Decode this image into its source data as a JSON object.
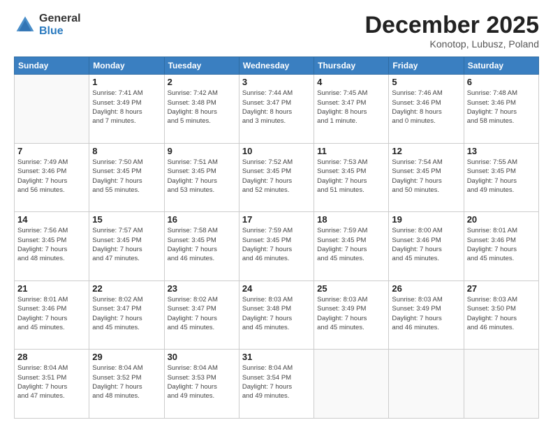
{
  "header": {
    "logo_general": "General",
    "logo_blue": "Blue",
    "month_title": "December 2025",
    "subtitle": "Konotop, Lubusz, Poland"
  },
  "weekdays": [
    "Sunday",
    "Monday",
    "Tuesday",
    "Wednesday",
    "Thursday",
    "Friday",
    "Saturday"
  ],
  "weeks": [
    [
      {
        "day": "",
        "info": ""
      },
      {
        "day": "1",
        "info": "Sunrise: 7:41 AM\nSunset: 3:49 PM\nDaylight: 8 hours\nand 7 minutes."
      },
      {
        "day": "2",
        "info": "Sunrise: 7:42 AM\nSunset: 3:48 PM\nDaylight: 8 hours\nand 5 minutes."
      },
      {
        "day": "3",
        "info": "Sunrise: 7:44 AM\nSunset: 3:47 PM\nDaylight: 8 hours\nand 3 minutes."
      },
      {
        "day": "4",
        "info": "Sunrise: 7:45 AM\nSunset: 3:47 PM\nDaylight: 8 hours\nand 1 minute."
      },
      {
        "day": "5",
        "info": "Sunrise: 7:46 AM\nSunset: 3:46 PM\nDaylight: 8 hours\nand 0 minutes."
      },
      {
        "day": "6",
        "info": "Sunrise: 7:48 AM\nSunset: 3:46 PM\nDaylight: 7 hours\nand 58 minutes."
      }
    ],
    [
      {
        "day": "7",
        "info": "Sunrise: 7:49 AM\nSunset: 3:46 PM\nDaylight: 7 hours\nand 56 minutes."
      },
      {
        "day": "8",
        "info": "Sunrise: 7:50 AM\nSunset: 3:45 PM\nDaylight: 7 hours\nand 55 minutes."
      },
      {
        "day": "9",
        "info": "Sunrise: 7:51 AM\nSunset: 3:45 PM\nDaylight: 7 hours\nand 53 minutes."
      },
      {
        "day": "10",
        "info": "Sunrise: 7:52 AM\nSunset: 3:45 PM\nDaylight: 7 hours\nand 52 minutes."
      },
      {
        "day": "11",
        "info": "Sunrise: 7:53 AM\nSunset: 3:45 PM\nDaylight: 7 hours\nand 51 minutes."
      },
      {
        "day": "12",
        "info": "Sunrise: 7:54 AM\nSunset: 3:45 PM\nDaylight: 7 hours\nand 50 minutes."
      },
      {
        "day": "13",
        "info": "Sunrise: 7:55 AM\nSunset: 3:45 PM\nDaylight: 7 hours\nand 49 minutes."
      }
    ],
    [
      {
        "day": "14",
        "info": "Sunrise: 7:56 AM\nSunset: 3:45 PM\nDaylight: 7 hours\nand 48 minutes."
      },
      {
        "day": "15",
        "info": "Sunrise: 7:57 AM\nSunset: 3:45 PM\nDaylight: 7 hours\nand 47 minutes."
      },
      {
        "day": "16",
        "info": "Sunrise: 7:58 AM\nSunset: 3:45 PM\nDaylight: 7 hours\nand 46 minutes."
      },
      {
        "day": "17",
        "info": "Sunrise: 7:59 AM\nSunset: 3:45 PM\nDaylight: 7 hours\nand 46 minutes."
      },
      {
        "day": "18",
        "info": "Sunrise: 7:59 AM\nSunset: 3:45 PM\nDaylight: 7 hours\nand 45 minutes."
      },
      {
        "day": "19",
        "info": "Sunrise: 8:00 AM\nSunset: 3:46 PM\nDaylight: 7 hours\nand 45 minutes."
      },
      {
        "day": "20",
        "info": "Sunrise: 8:01 AM\nSunset: 3:46 PM\nDaylight: 7 hours\nand 45 minutes."
      }
    ],
    [
      {
        "day": "21",
        "info": "Sunrise: 8:01 AM\nSunset: 3:46 PM\nDaylight: 7 hours\nand 45 minutes."
      },
      {
        "day": "22",
        "info": "Sunrise: 8:02 AM\nSunset: 3:47 PM\nDaylight: 7 hours\nand 45 minutes."
      },
      {
        "day": "23",
        "info": "Sunrise: 8:02 AM\nSunset: 3:47 PM\nDaylight: 7 hours\nand 45 minutes."
      },
      {
        "day": "24",
        "info": "Sunrise: 8:03 AM\nSunset: 3:48 PM\nDaylight: 7 hours\nand 45 minutes."
      },
      {
        "day": "25",
        "info": "Sunrise: 8:03 AM\nSunset: 3:49 PM\nDaylight: 7 hours\nand 45 minutes."
      },
      {
        "day": "26",
        "info": "Sunrise: 8:03 AM\nSunset: 3:49 PM\nDaylight: 7 hours\nand 46 minutes."
      },
      {
        "day": "27",
        "info": "Sunrise: 8:03 AM\nSunset: 3:50 PM\nDaylight: 7 hours\nand 46 minutes."
      }
    ],
    [
      {
        "day": "28",
        "info": "Sunrise: 8:04 AM\nSunset: 3:51 PM\nDaylight: 7 hours\nand 47 minutes."
      },
      {
        "day": "29",
        "info": "Sunrise: 8:04 AM\nSunset: 3:52 PM\nDaylight: 7 hours\nand 48 minutes."
      },
      {
        "day": "30",
        "info": "Sunrise: 8:04 AM\nSunset: 3:53 PM\nDaylight: 7 hours\nand 49 minutes."
      },
      {
        "day": "31",
        "info": "Sunrise: 8:04 AM\nSunset: 3:54 PM\nDaylight: 7 hours\nand 49 minutes."
      },
      {
        "day": "",
        "info": ""
      },
      {
        "day": "",
        "info": ""
      },
      {
        "day": "",
        "info": ""
      }
    ]
  ]
}
